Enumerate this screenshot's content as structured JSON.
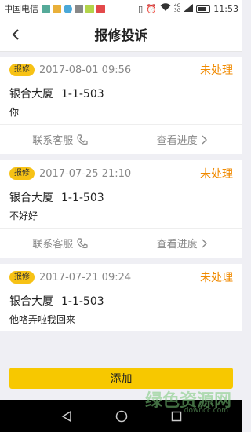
{
  "statusbar": {
    "carrier": "中国电信",
    "time": "11:53",
    "net_top": "4G",
    "net_bottom": "3G"
  },
  "header": {
    "title": "报修投诉"
  },
  "items": [
    {
      "badge": "报修",
      "date": "2017-08-01 09:56",
      "status": "未处理",
      "building": "银合大厦",
      "unit": "1-1-503",
      "message": "你",
      "contact_label": "联系客服",
      "progress_label": "查看进度"
    },
    {
      "badge": "报修",
      "date": "2017-07-25 21:10",
      "status": "未处理",
      "building": "银合大厦",
      "unit": "1-1-503",
      "message": "不好好",
      "contact_label": "联系客服",
      "progress_label": "查看进度"
    },
    {
      "badge": "报修",
      "date": "2017-07-21 09:24",
      "status": "未处理",
      "building": "银合大厦",
      "unit": "1-1-503",
      "message": "他咯弄啦我回来",
      "contact_label": "联系客服",
      "progress_label": "查看进度"
    }
  ],
  "add_button": {
    "label": "添加"
  },
  "watermark": {
    "text": "绿色资源网",
    "url": "downcc.com"
  },
  "colors": {
    "accent": "#f7c800",
    "status": "#f08a00",
    "badge": "#f7c215"
  }
}
